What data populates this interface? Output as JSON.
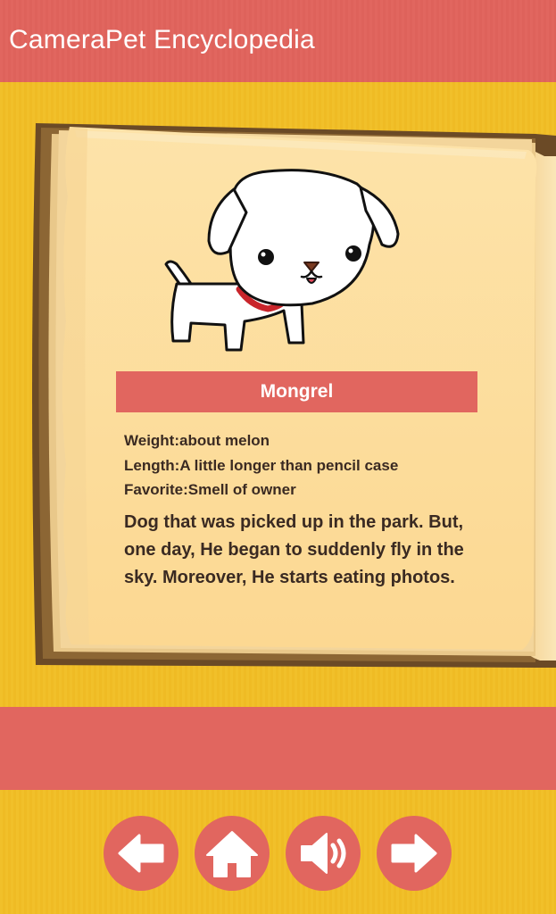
{
  "app_bar": {
    "title": "CameraPet Encyclopedia"
  },
  "pet": {
    "name": "Mongrel",
    "illustration": "white-puppy-with-red-collar",
    "stats": [
      "Weight:about melon",
      "Length:A little longer than pencil case",
      "Favorite:Smell of owner"
    ],
    "description": "Dog that was picked up in the park. But, one day, He began to suddenly fly in the sky. Moreover, He starts eating photos."
  },
  "nav": {
    "buttons": [
      {
        "name": "previous-button",
        "icon": "arrow-left-icon"
      },
      {
        "name": "home-button",
        "icon": "home-icon"
      },
      {
        "name": "sound-button",
        "icon": "speaker-icon"
      },
      {
        "name": "next-button",
        "icon": "arrow-right-icon"
      }
    ]
  },
  "colors": {
    "accent_red": "#e1665f",
    "background_yellow": "#f1c02a",
    "page_paper": "#fde0a4",
    "text_dark": "#3a2a22"
  }
}
